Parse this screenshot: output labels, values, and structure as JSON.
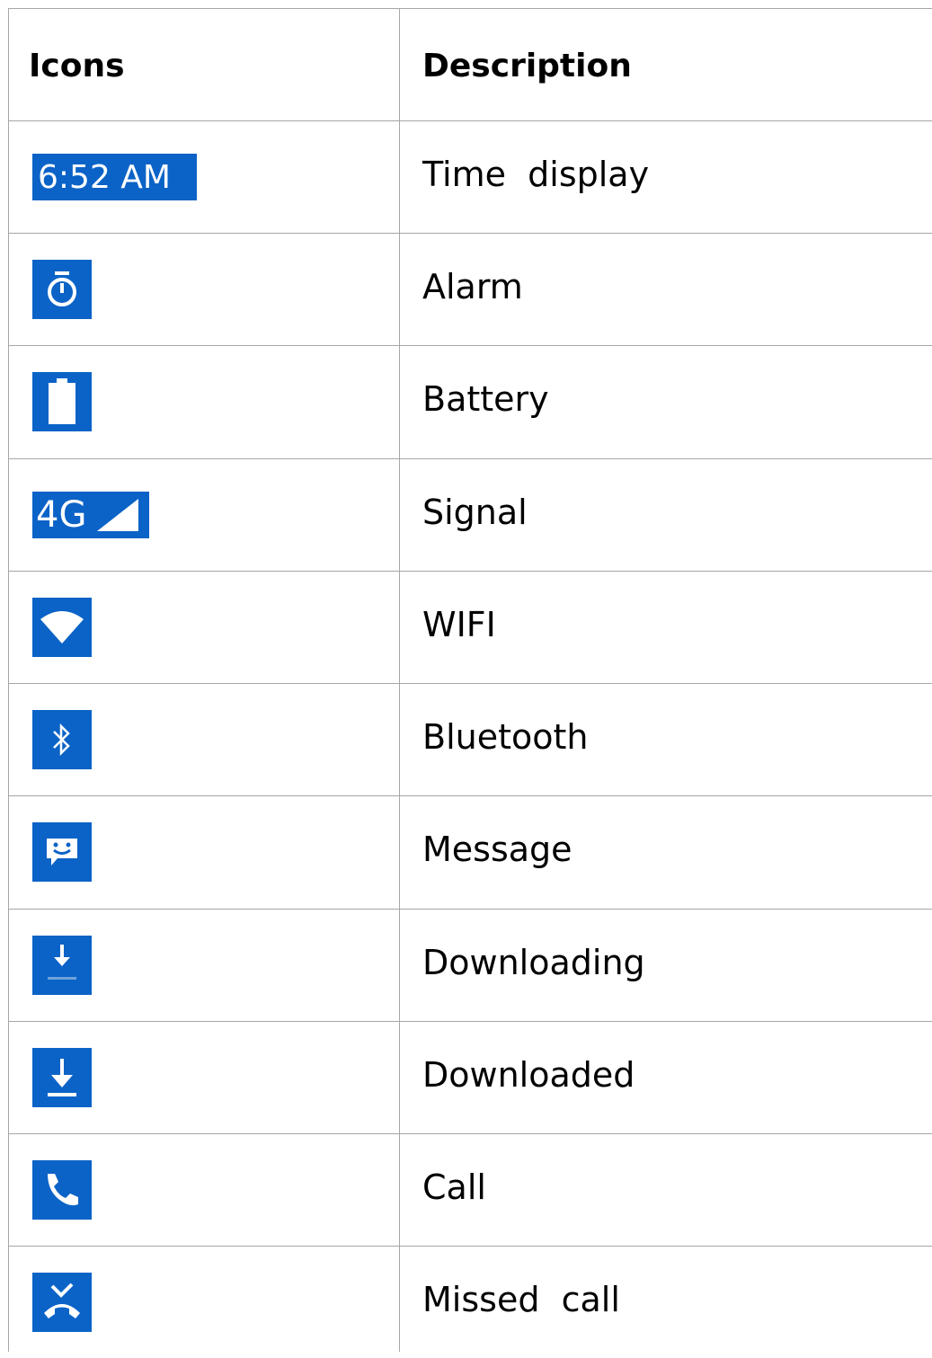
{
  "header": {
    "col_icons": "Icons",
    "col_description": "Description"
  },
  "accent_color": "#0b63c7",
  "rows": [
    {
      "icon": "time-display-icon",
      "icon_text": "6:52 AM",
      "description": "Time  display"
    },
    {
      "icon": "alarm-icon",
      "description": "Alarm"
    },
    {
      "icon": "battery-icon",
      "description": "Battery"
    },
    {
      "icon": "signal-icon",
      "icon_text": "4G",
      "description": "Signal"
    },
    {
      "icon": "wifi-icon",
      "description": "WIFI"
    },
    {
      "icon": "bluetooth-icon",
      "description": "Bluetooth"
    },
    {
      "icon": "message-icon",
      "description": "Message"
    },
    {
      "icon": "downloading-icon",
      "description": "Downloading"
    },
    {
      "icon": "downloaded-icon",
      "description": "Downloaded"
    },
    {
      "icon": "call-icon",
      "description": "Call"
    },
    {
      "icon": "missed-call-icon",
      "description": "Missed  call"
    }
  ]
}
